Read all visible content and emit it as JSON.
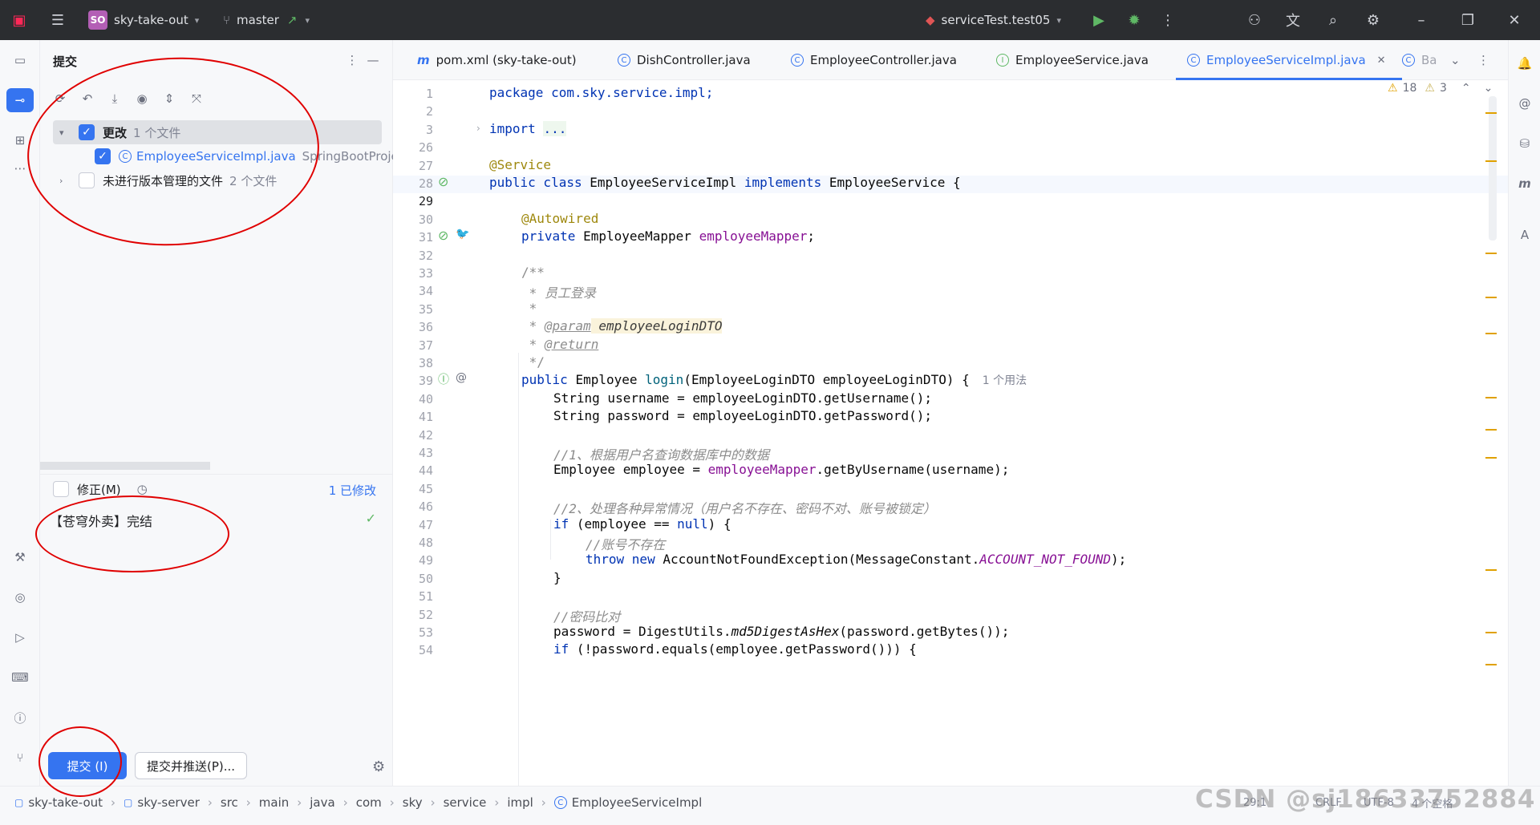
{
  "titlebar": {
    "project_badge": "SO",
    "project_name": "sky-take-out",
    "branch": "master",
    "run_config": "serviceTest.test05"
  },
  "commit_panel": {
    "title": "提交",
    "changes_label": "更改",
    "changes_count": "1 个文件",
    "changed_file": "EmployeeServiceImpl.java",
    "changed_file_module": "SpringBootProject",
    "unversioned_label": "未进行版本管理的文件",
    "unversioned_count": "2 个文件",
    "amend_label": "修正(M)",
    "modified_count": "1 已修改",
    "commit_message": "【苍穹外卖】完结",
    "commit_button": "提交 (I)",
    "commit_push_button": "提交并推送(P)..."
  },
  "tabs": [
    {
      "label": "pom.xml (sky-take-out)"
    },
    {
      "label": "DishController.java"
    },
    {
      "label": "EmployeeController.java"
    },
    {
      "label": "EmployeeService.java"
    },
    {
      "label": "EmployeeServiceImpl.java"
    },
    {
      "label": "Ba"
    }
  ],
  "inspections": {
    "warnings": "18",
    "weak_warnings": "3"
  },
  "code": {
    "l1": {
      "num": "1",
      "text": "package com.sky.service.impl;"
    },
    "l2": {
      "num": "2"
    },
    "l3": {
      "num": "3",
      "text": "..."
    },
    "l26": {
      "num": "26"
    },
    "l27": {
      "num": "27",
      "text": "@Service"
    },
    "l28": {
      "num": "28",
      "a": "public class ",
      "b": "EmployeeServiceImpl ",
      "c": "implements ",
      "d": "EmployeeService {"
    },
    "l29": {
      "num": "29"
    },
    "l30": {
      "num": "30",
      "text": "@Autowired"
    },
    "l31": {
      "num": "31",
      "a": "private ",
      "b": "EmployeeMapper ",
      "c": "employeeMapper",
      "d": ";"
    },
    "l32": {
      "num": "32"
    },
    "l33": {
      "num": "33",
      "text": "/**"
    },
    "l34": {
      "num": "34",
      "text": " * 员工登录"
    },
    "l35": {
      "num": "35",
      "text": " *"
    },
    "l36": {
      "num": "36",
      "a": " * ",
      "b": "@param",
      "c": " employeeLoginDTO"
    },
    "l37": {
      "num": "37",
      "a": " * ",
      "b": "@return"
    },
    "l38": {
      "num": "38",
      "text": " */"
    },
    "l39": {
      "num": "39",
      "a": "public ",
      "b": "Employee ",
      "c": "login",
      "d": "(EmployeeLoginDTO employeeLoginDTO) {",
      "hint": "1 个用法"
    },
    "l40": {
      "num": "40",
      "text": "String username = employeeLoginDTO.getUsername();"
    },
    "l41": {
      "num": "41",
      "text": "String password = employeeLoginDTO.getPassword();"
    },
    "l42": {
      "num": "42"
    },
    "l43": {
      "num": "43",
      "text": "//1、根据用户名查询数据库中的数据"
    },
    "l44": {
      "num": "44",
      "a": "Employee employee = ",
      "b": "employeeMapper",
      "c": ".getByUsername(username);"
    },
    "l45": {
      "num": "45"
    },
    "l46": {
      "num": "46",
      "text": "//2、处理各种异常情况（用户名不存在、密码不对、账号被锁定）"
    },
    "l47": {
      "num": "47",
      "a": "if ",
      "b": "(employee == ",
      "c": "null",
      "d": ") {"
    },
    "l48": {
      "num": "48",
      "text": "//账号不存在"
    },
    "l49": {
      "num": "49",
      "a": "throw new ",
      "b": "AccountNotFoundException(MessageConstant.",
      "c": "ACCOUNT_NOT_FOUND",
      "d": ");"
    },
    "l50": {
      "num": "50",
      "text": "}"
    },
    "l51": {
      "num": "51"
    },
    "l52": {
      "num": "52",
      "text": "//密码比对"
    },
    "l53": {
      "num": "53",
      "a": "password = DigestUtils.",
      "b": "md5DigestAsHex",
      "c": "(password.getBytes());"
    },
    "l54": {
      "num": "54",
      "a": "if ",
      "b": "(!password.equals(employee.getPassword())) {"
    }
  },
  "statusbar": {
    "crumbs": [
      "sky-take-out",
      "sky-server",
      "src",
      "main",
      "java",
      "com",
      "sky",
      "service",
      "impl",
      "EmployeeServiceImpl"
    ],
    "position": "29:1",
    "line_sep": "CRLF",
    "encoding": "UTF-8",
    "indent": "4 个空格"
  },
  "watermark": "CSDN @sj18633752884"
}
